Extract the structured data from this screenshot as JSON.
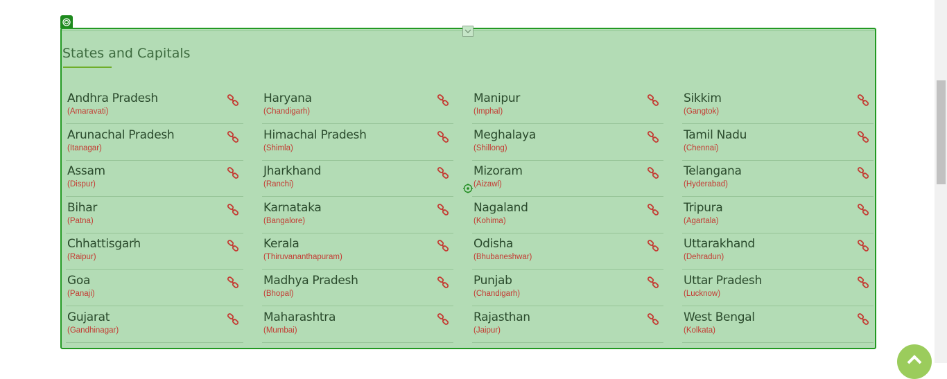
{
  "section": {
    "title": "States and Capitals"
  },
  "icons": {
    "link": "link-icon",
    "collapse": "chevron-down-icon",
    "edit_handle": "target-icon",
    "back_to_top": "chevron-up-icon"
  },
  "colors": {
    "panel_bg": "#b3dcb5",
    "panel_border": "#229922",
    "state_text": "#2a4a2c",
    "capital_text": "#c43a32",
    "link_icon": "#c43a32",
    "accent": "#6fae2a"
  },
  "columns": [
    [
      {
        "state": "Andhra Pradesh",
        "capital": "(Amaravati)"
      },
      {
        "state": "Arunachal Pradesh",
        "capital": "(Itanagar)"
      },
      {
        "state": "Assam",
        "capital": "(Dispur)"
      },
      {
        "state": "Bihar",
        "capital": "(Patna)"
      },
      {
        "state": "Chhattisgarh",
        "capital": "(Raipur)"
      },
      {
        "state": "Goa",
        "capital": "(Panaji)"
      },
      {
        "state": "Gujarat",
        "capital": "(Gandhinagar)"
      }
    ],
    [
      {
        "state": "Haryana",
        "capital": "(Chandigarh)"
      },
      {
        "state": "Himachal Pradesh",
        "capital": "(Shimla)"
      },
      {
        "state": "Jharkhand",
        "capital": "(Ranchi)"
      },
      {
        "state": "Karnataka",
        "capital": "(Bangalore)"
      },
      {
        "state": "Kerala",
        "capital": "(Thiruvananthapuram)"
      },
      {
        "state": "Madhya Pradesh",
        "capital": "(Bhopal)"
      },
      {
        "state": "Maharashtra",
        "capital": "(Mumbai)"
      }
    ],
    [
      {
        "state": "Manipur",
        "capital": "(Imphal)"
      },
      {
        "state": "Meghalaya",
        "capital": "(Shillong)"
      },
      {
        "state": "Mizoram",
        "capital": "(Aizawl)"
      },
      {
        "state": "Nagaland",
        "capital": "(Kohima)"
      },
      {
        "state": "Odisha",
        "capital": "(Bhubaneshwar)"
      },
      {
        "state": "Punjab",
        "capital": "(Chandigarh)"
      },
      {
        "state": "Rajasthan",
        "capital": "(Jaipur)"
      }
    ],
    [
      {
        "state": "Sikkim",
        "capital": "(Gangtok)"
      },
      {
        "state": "Tamil Nadu",
        "capital": "(Chennai)"
      },
      {
        "state": "Telangana",
        "capital": "(Hyderabad)"
      },
      {
        "state": "Tripura",
        "capital": "(Agartala)"
      },
      {
        "state": "Uttarakhand",
        "capital": "(Dehradun)"
      },
      {
        "state": "Uttar Pradesh",
        "capital": "(Lucknow)"
      },
      {
        "state": "West Bengal",
        "capital": "(Kolkata)"
      }
    ]
  ]
}
